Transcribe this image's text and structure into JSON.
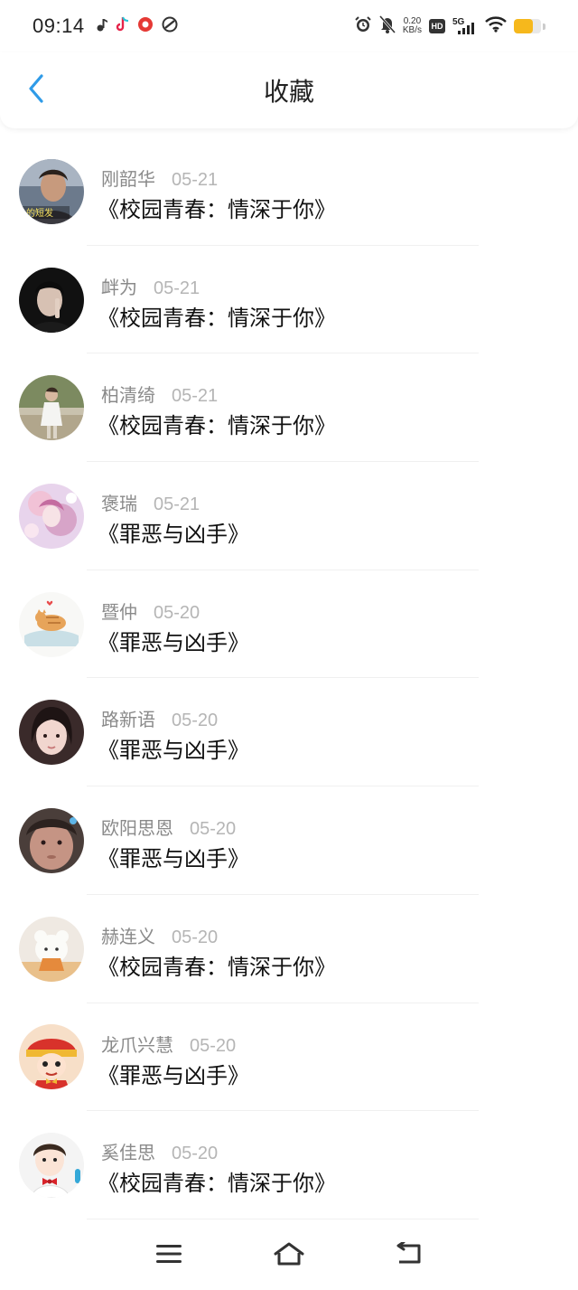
{
  "status_bar": {
    "time": "09:14",
    "net_speed_value": "0.20",
    "net_speed_unit": "KB/s",
    "hd_label": "HD",
    "signal_label": "5G",
    "app_icons": [
      "music-note-icon",
      "tiktok-icon",
      "red-app-icon",
      "link-app-icon"
    ],
    "battery_color": "#f6b81c"
  },
  "header": {
    "title": "收藏",
    "back_icon": "chevron-left-icon",
    "accent_color": "#2f9be8"
  },
  "items": [
    {
      "name": "刚韶华",
      "date": "05-21",
      "book": "《校园青春：情深于你》",
      "avatar_text": "的短发"
    },
    {
      "name": "衅为",
      "date": "05-21",
      "book": "《校园青春：情深于你》"
    },
    {
      "name": "柏清绮",
      "date": "05-21",
      "book": "《校园青春：情深于你》"
    },
    {
      "name": "褒瑞",
      "date": "05-21",
      "book": "《罪恶与凶手》"
    },
    {
      "name": "暨仲",
      "date": "05-20",
      "book": "《罪恶与凶手》"
    },
    {
      "name": "路新语",
      "date": "05-20",
      "book": "《罪恶与凶手》"
    },
    {
      "name": "欧阳思恩",
      "date": "05-20",
      "book": "《罪恶与凶手》"
    },
    {
      "name": "赫连义",
      "date": "05-20",
      "book": "《校园青春：情深于你》"
    },
    {
      "name": "龙爪兴慧",
      "date": "05-20",
      "book": "《罪恶与凶手》"
    },
    {
      "name": "奚佳思",
      "date": "05-20",
      "book": "《校园青春：情深于你》"
    }
  ],
  "navbar": {
    "menu_icon": "menu-icon",
    "home_icon": "home-icon",
    "back_icon": "back-icon"
  }
}
